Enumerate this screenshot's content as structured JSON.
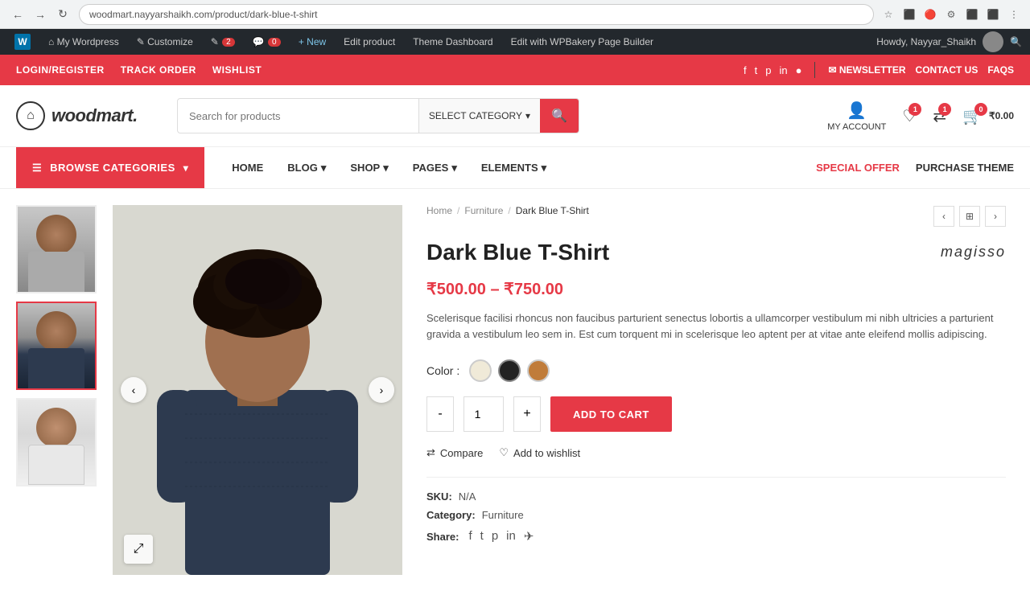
{
  "browser": {
    "url": "woodmart.nayyarshaikh.com/product/dark-blue-t-shirt",
    "back_label": "←",
    "forward_label": "→",
    "refresh_label": "↻"
  },
  "wp_admin": {
    "wp_icon": "W",
    "items": [
      {
        "label": "My Wordpress",
        "badge": null
      },
      {
        "label": "Customize",
        "badge": null
      },
      {
        "label": "2",
        "badge": "2",
        "icon": "✎"
      },
      {
        "label": "0",
        "badge": "0",
        "icon": "💬"
      },
      {
        "label": "+ New",
        "badge": null
      },
      {
        "label": "Edit product",
        "badge": null
      },
      {
        "label": "Theme Dashboard",
        "badge": null
      },
      {
        "label": "Edit with WPBakery Page Builder",
        "badge": null
      }
    ],
    "howdy": "Howdy, Nayyar_Shaikh"
  },
  "topbar": {
    "links": [
      "LOGIN/REGISTER",
      "TRACK ORDER",
      "WISHLIST"
    ],
    "social": [
      "f",
      "t",
      "p",
      "in",
      "●"
    ],
    "newsletter_label": "✉ NEWSLETTER",
    "contact_label": "CONTACT US",
    "faqs_label": "FAQS"
  },
  "header": {
    "logo_text": "woodmart.",
    "logo_icon": "⌂",
    "search_placeholder": "Search for products",
    "search_category": "SELECT CATEGORY",
    "account_label": "MY ACCOUNT",
    "wishlist_badge": "1",
    "compare_badge": "1",
    "cart_badge": "0",
    "cart_amount": "₹0.00"
  },
  "nav": {
    "browse_categories": "BROWSE CATEGORIES",
    "links": [
      {
        "label": "HOME",
        "has_dropdown": false
      },
      {
        "label": "BLOG",
        "has_dropdown": true
      },
      {
        "label": "SHOP",
        "has_dropdown": true
      },
      {
        "label": "PAGES",
        "has_dropdown": true
      },
      {
        "label": "ELEMENTS",
        "has_dropdown": true
      }
    ],
    "special_offer": "SPECIAL OFFER",
    "purchase_theme": "PURCHASE THEME"
  },
  "product": {
    "breadcrumb": [
      "Home",
      "Furniture",
      "Dark Blue T-Shirt"
    ],
    "title": "Dark Blue T-Shirt",
    "brand": "magisso",
    "price": "₹500.00 – ₹750.00",
    "description": "Scelerisque facilisi rhoncus non faucibus parturient senectus lobortis a ullamcorper vestibulum mi nibh ultricies a parturient gravida a vestibulum leo sem in. Est cum torquent mi in scelerisque leo aptent per at vitae ante eleifend mollis adipiscing.",
    "color_label": "Color :",
    "colors": [
      {
        "name": "cream",
        "hex": "#f0ead8",
        "active": false
      },
      {
        "name": "black",
        "hex": "#222222",
        "active": true
      },
      {
        "name": "tan",
        "hex": "#c07c3a",
        "active": false
      }
    ],
    "quantity": "1",
    "add_to_cart": "ADD TO CART",
    "minus_label": "-",
    "plus_label": "+",
    "compare_label": "Compare",
    "wishlist_label": "Add to wishlist",
    "sku_label": "SKU:",
    "sku_value": "N/A",
    "category_label": "Category:",
    "category_value": "Furniture",
    "share_label": "Share:",
    "thumbnails": [
      {
        "alt": "Gray T-Shirt front"
      },
      {
        "alt": "Dark Blue T-Shirt front"
      },
      {
        "alt": "White T-Shirt front"
      }
    ]
  }
}
